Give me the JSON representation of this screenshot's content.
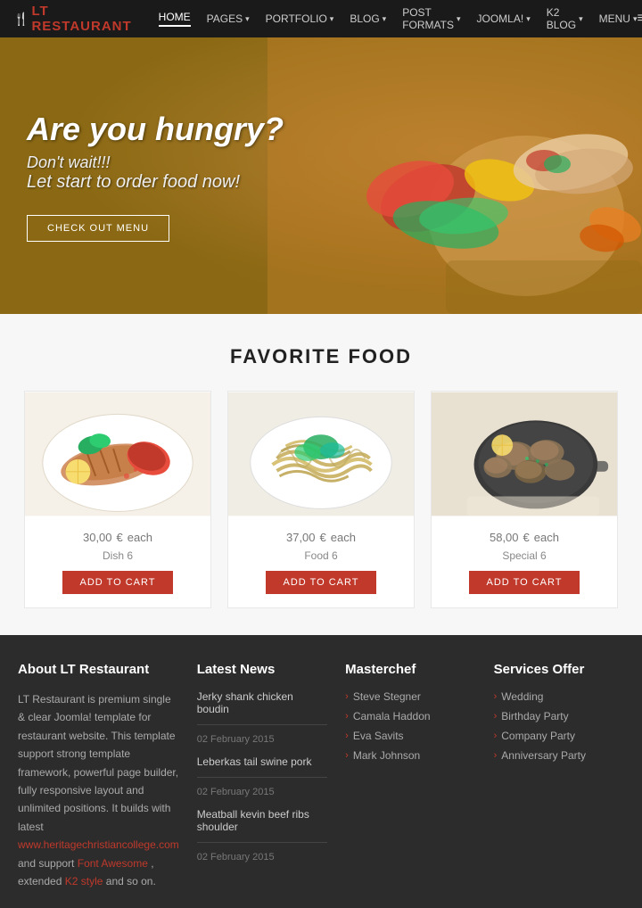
{
  "header": {
    "logo_prefix": "LT",
    "logo_brand": "RESTAURANT",
    "nav_items": [
      {
        "label": "HOME",
        "active": true
      },
      {
        "label": "PAGES",
        "dropdown": true
      },
      {
        "label": "PORTFOLIO",
        "dropdown": true
      },
      {
        "label": "BLOG",
        "dropdown": true
      },
      {
        "label": "POST FORMATS",
        "dropdown": true
      },
      {
        "label": "JOOMLA!",
        "dropdown": true
      },
      {
        "label": "K2 BLOG",
        "dropdown": true
      },
      {
        "label": "MENU",
        "dropdown": true
      }
    ]
  },
  "hero": {
    "title": "Are you hungry?",
    "subtitle": "Don't wait!!!",
    "tagline": "Let start to order food now!",
    "cta_label": "CHECK OUT MENU"
  },
  "favorite_food": {
    "section_title": "FAVORITE FOOD",
    "items": [
      {
        "price": "30,00",
        "currency": "€",
        "unit": "each",
        "name": "Dish 6",
        "btn": "ADD TO CART"
      },
      {
        "price": "37,00",
        "currency": "€",
        "unit": "each",
        "name": "Food 6",
        "btn": "ADD TO CART"
      },
      {
        "price": "58,00",
        "currency": "€",
        "unit": "each",
        "name": "Special 6",
        "btn": "ADD TO CART"
      }
    ]
  },
  "footer": {
    "about": {
      "title": "About LT Restaurant",
      "text": "LT Restaurant is premium single & clear Joomla! template for restaurant website. This template support strong template framework, powerful page builder, fully responsive layout and unlimited positions. It builds with latest",
      "link1_text": "www.heritagechristiancollege.com",
      "link1_url": "#",
      "text2": "and support",
      "link2_text": "Font Awesome",
      "link2_url": "#",
      "text3": ", extended",
      "link3_text": "K2 style",
      "link3_url": "#",
      "text4": "and so on."
    },
    "news": {
      "title": "Latest News",
      "items": [
        {
          "title": "Jerky shank chicken boudin",
          "date": "02 February 2015"
        },
        {
          "title": "Leberkas tail swine pork",
          "date": "02 February 2015"
        },
        {
          "title": "Meatball kevin beef ribs shoulder",
          "date": "02 February 2015"
        }
      ]
    },
    "masterchef": {
      "title": "Masterchef",
      "items": [
        "Steve Stegner",
        "Camala Haddon",
        "Eva Savits",
        "Mark Johnson"
      ]
    },
    "services": {
      "title": "Services Offer",
      "items": [
        "Wedding",
        "Birthday Party",
        "Company Party",
        "Anniversary Party"
      ]
    }
  }
}
